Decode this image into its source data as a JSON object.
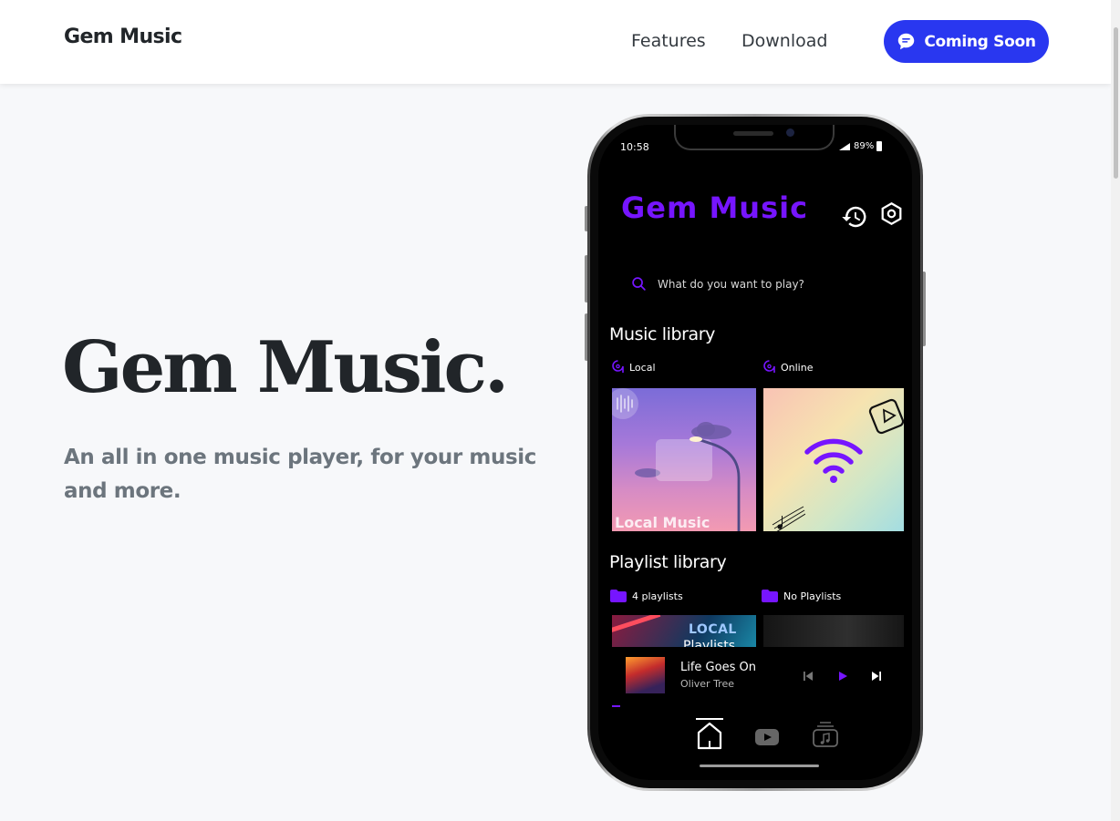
{
  "nav": {
    "brand": "Gem Music",
    "links": [
      "Features",
      "Download"
    ],
    "cta_label": "Coming Soon",
    "cta_icon": "chat-bubble-icon",
    "cta_color": "#2937f0"
  },
  "hero": {
    "title": "Gem Music.",
    "subtitle": "An all in one music player, for your music and more."
  },
  "phone": {
    "status_bar": {
      "time": "10:58",
      "battery": "89%"
    },
    "app": {
      "title": "Gem Music",
      "accent_color": "#7615ff",
      "search_placeholder": "What do you want to play?",
      "music_library": {
        "title": "Music library",
        "categories": [
          {
            "label": "Local",
            "icon": "music-note-icon",
            "card_text": "Local Music"
          },
          {
            "label": "Online",
            "icon": "music-note-icon",
            "card_icon": "wifi-icon"
          }
        ]
      },
      "playlist_library": {
        "title": "Playlist library",
        "categories": [
          {
            "label": "4 playlists",
            "icon": "folder-icon",
            "card_text": "LOCAL",
            "card_text2": "Playlists"
          },
          {
            "label": "No Playlists",
            "icon": "folder-icon"
          }
        ]
      },
      "now_playing": {
        "song": "Life Goes On",
        "artist": "Oliver Tree",
        "controls": [
          "skip-previous-icon",
          "play-icon",
          "skip-next-icon"
        ]
      },
      "bottom_nav": [
        "home-icon",
        "youtube-icon",
        "library-icon"
      ]
    }
  }
}
